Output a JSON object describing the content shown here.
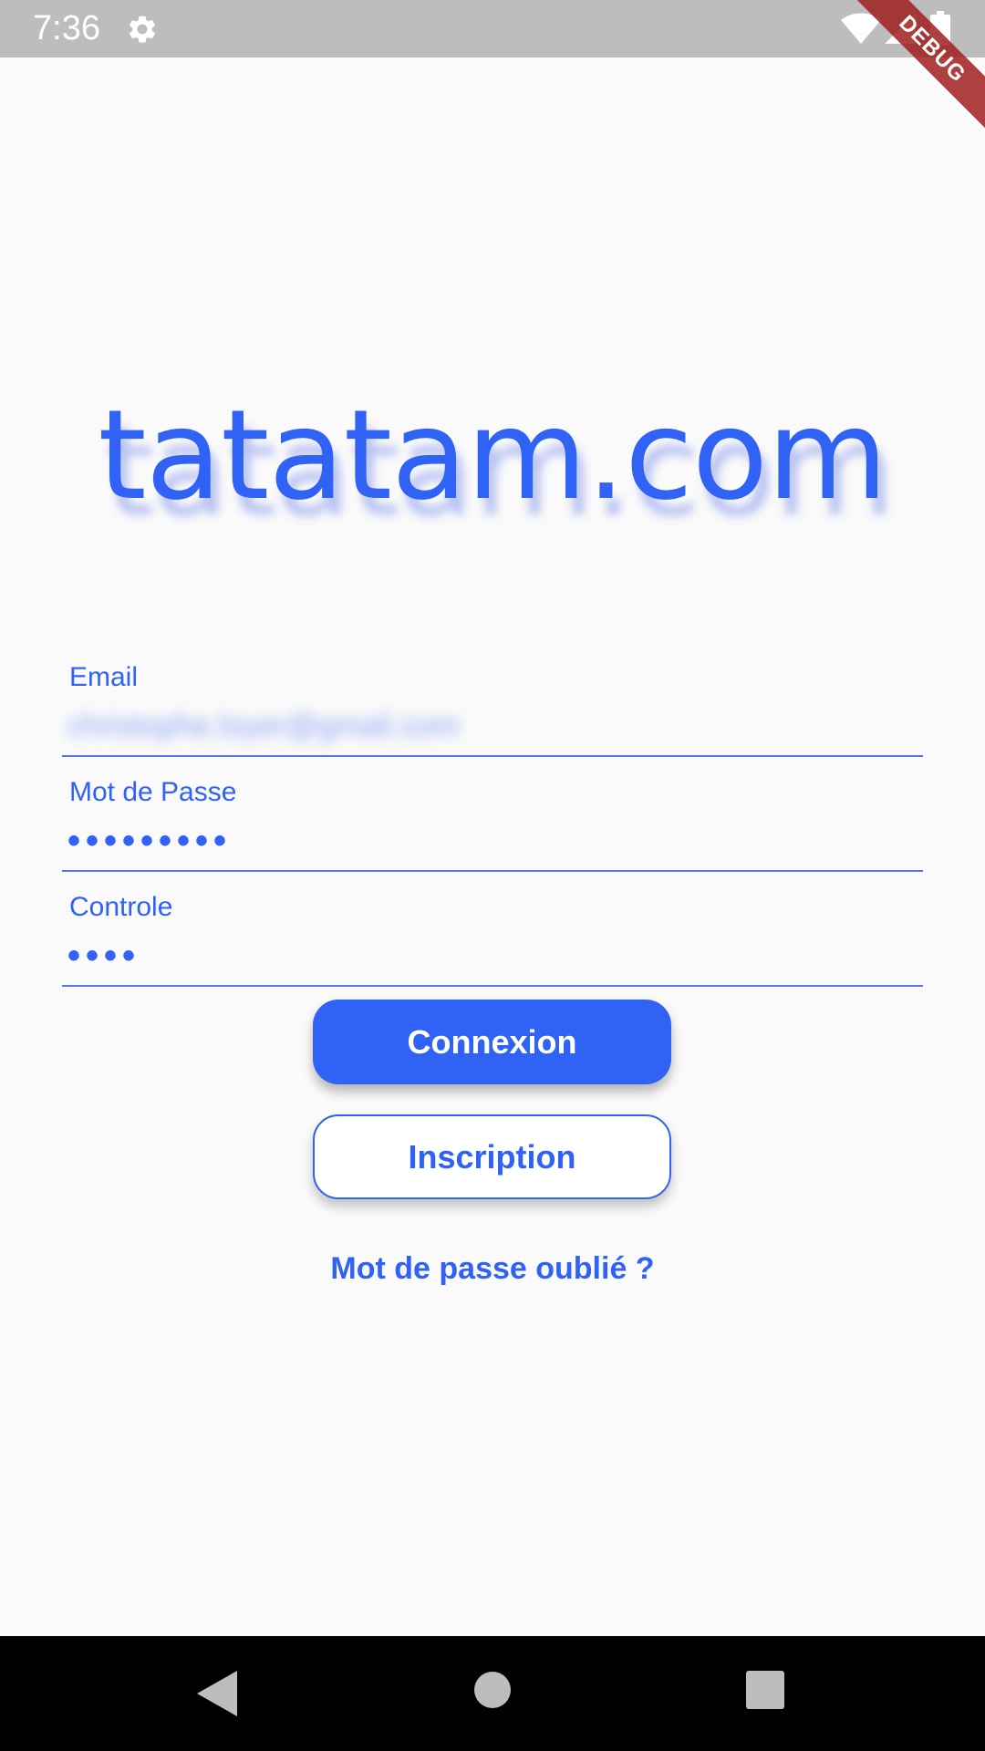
{
  "status_bar": {
    "time": "7:36",
    "icons": [
      "gear-icon",
      "wifi-icon",
      "signal-icon",
      "battery-icon"
    ]
  },
  "debug_banner": "DEBUG",
  "logo_text": "tatatam.com",
  "form": {
    "email": {
      "label": "Email",
      "value": "christophe.loyer@gmail.com"
    },
    "password": {
      "label": "Mot de Passe",
      "value": "•••••••••"
    },
    "confirm": {
      "label": "Controle",
      "value": "••••"
    }
  },
  "buttons": {
    "login": "Connexion",
    "signup": "Inscription"
  },
  "forgot_password": "Mot de passe oublié ?",
  "nav": {
    "icons": [
      "back-icon",
      "home-icon",
      "recent-apps-icon"
    ]
  },
  "colors": {
    "accent": "#2f62f5",
    "status_bar": "#bdbdbd",
    "background": "#fafafa",
    "debug_ribbon": "#a01e1e"
  }
}
